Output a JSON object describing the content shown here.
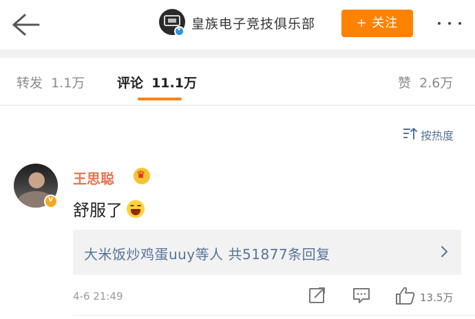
{
  "header": {
    "account_name": "皇族电子竞技俱乐部",
    "follow_label": "+ 关注",
    "icons": {
      "back": "back-arrow-icon",
      "more": "more-dots-icon",
      "verified": "verified-badge-icon"
    }
  },
  "tabs": [
    {
      "label": "转发",
      "count": "1.1万",
      "active": false
    },
    {
      "label": "评论",
      "count": "11.1万",
      "active": true
    },
    {
      "label": "赞",
      "count": "2.6万",
      "active": false
    }
  ],
  "sort": {
    "label": "按热度",
    "icon": "sort-icon"
  },
  "comment": {
    "author": "王思聪",
    "badge_icon": "crown-vip-icon",
    "text": "舒服了",
    "emoji_icon": "laughing-emoji-icon",
    "reply_summary": "大米饭炒鸡蛋uuy等人  共51877条回复",
    "time": "4-6 21:49",
    "likes": "13.5万",
    "action_icons": [
      "share-icon",
      "reply-icon",
      "like-icon"
    ]
  },
  "colors": {
    "accent": "#ff8200",
    "link": "#56739a",
    "username": "#eb7350",
    "verified_blue": "#2d92e0",
    "verified_gold": "#f5a623"
  }
}
